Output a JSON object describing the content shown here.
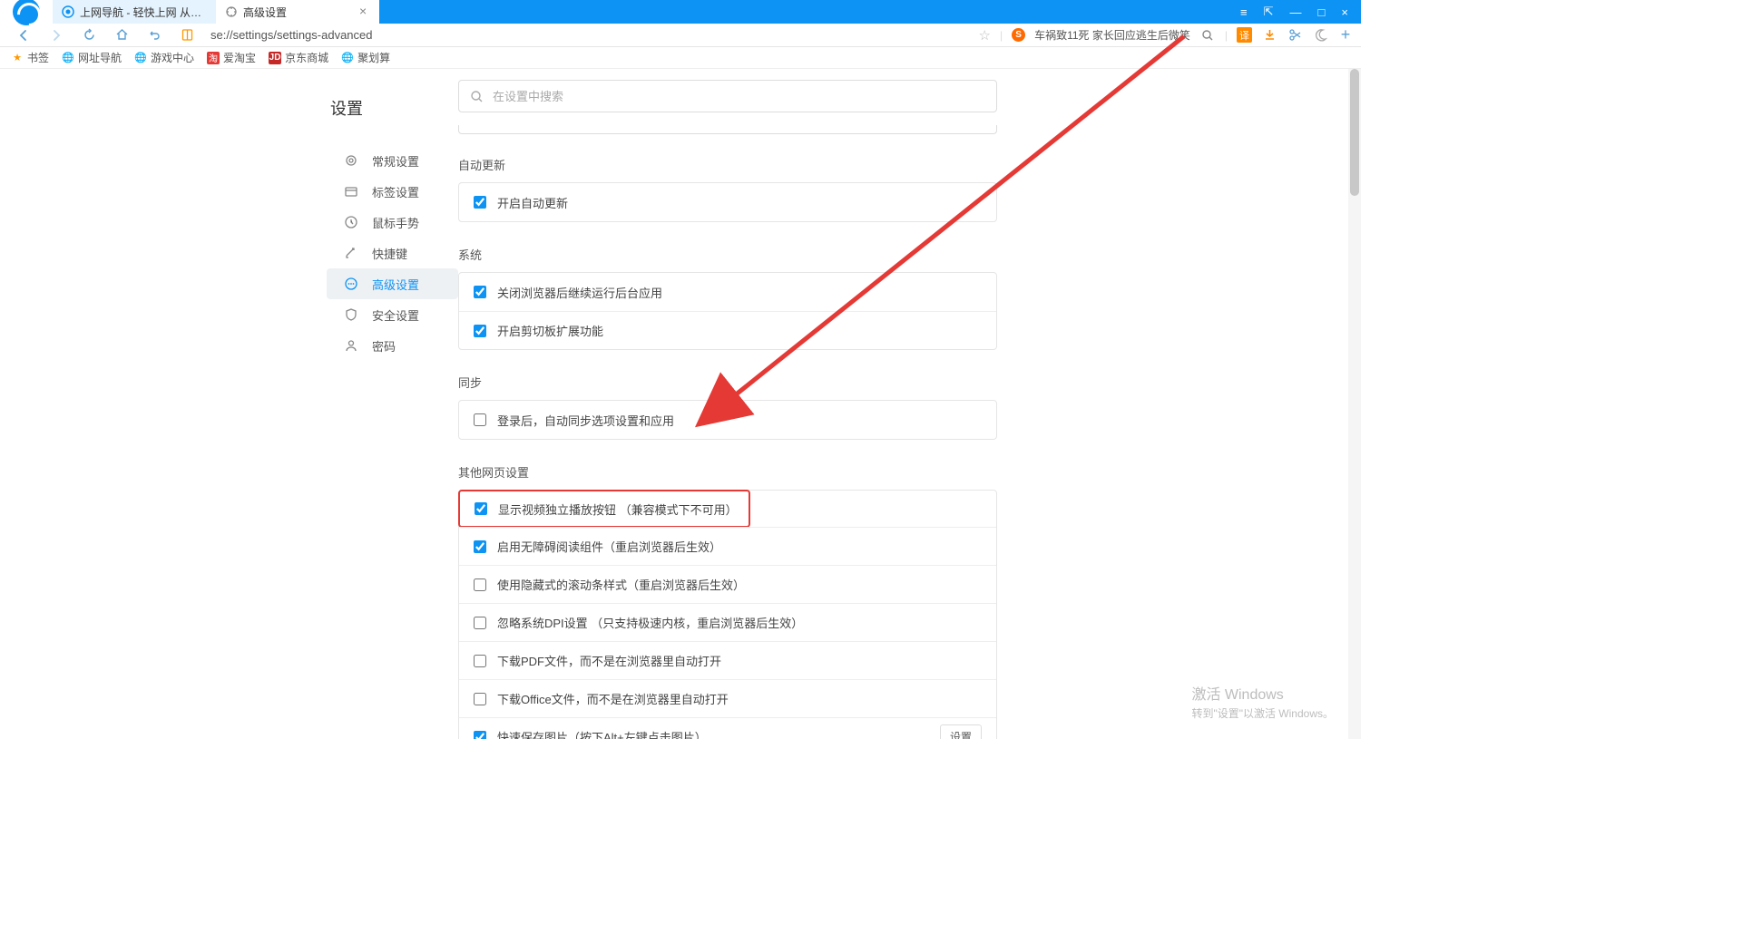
{
  "titlebar": {
    "tabs": [
      {
        "title": "上网导航 - 轻快上网 从这里开始",
        "active": false
      },
      {
        "title": "高级设置",
        "active": true
      }
    ]
  },
  "addressbar": {
    "url": "se://settings/settings-advanced",
    "news_text": "车祸致11死 家长回应逃生后微笑"
  },
  "bookmarks": {
    "items": [
      {
        "label": "书签"
      },
      {
        "label": "网址导航"
      },
      {
        "label": "游戏中心"
      },
      {
        "label": "爱淘宝"
      },
      {
        "label": "京东商城"
      },
      {
        "label": "聚划算"
      }
    ]
  },
  "settings": {
    "page_title": "设置",
    "search_placeholder": "在设置中搜索",
    "menu": [
      {
        "label": "常规设置",
        "icon": "gear"
      },
      {
        "label": "标签设置",
        "icon": "tab"
      },
      {
        "label": "鼠标手势",
        "icon": "mouse"
      },
      {
        "label": "快捷键",
        "icon": "shortcut"
      },
      {
        "label": "高级设置",
        "icon": "dots",
        "active": true
      },
      {
        "label": "安全设置",
        "icon": "shield"
      },
      {
        "label": "密码",
        "icon": "person"
      }
    ],
    "sections": {
      "auto_update": {
        "title": "自动更新",
        "items": [
          {
            "label": "开启自动更新",
            "checked": true
          }
        ]
      },
      "system": {
        "title": "系统",
        "items": [
          {
            "label": "关闭浏览器后继续运行后台应用",
            "checked": true
          },
          {
            "label": "开启剪切板扩展功能",
            "checked": true
          }
        ]
      },
      "sync": {
        "title": "同步",
        "items": [
          {
            "label": "登录后，自动同步选项设置和应用",
            "checked": false
          }
        ]
      },
      "other": {
        "title": "其他网页设置",
        "items": [
          {
            "label": "显示视频独立播放按钮 （兼容模式下不可用）",
            "checked": true,
            "highlight": true
          },
          {
            "label": "启用无障碍阅读组件（重启浏览器后生效）",
            "checked": true
          },
          {
            "label": "使用隐藏式的滚动条样式（重启浏览器后生效）",
            "checked": false
          },
          {
            "label": "忽略系统DPI设置 （只支持极速内核，重启浏览器后生效）",
            "checked": false
          },
          {
            "label": "下载PDF文件，而不是在浏览器里自动打开",
            "checked": false
          },
          {
            "label": "下载Office文件，而不是在浏览器里自动打开",
            "checked": false
          },
          {
            "label": "快速保存图片（按下Alt+左键点击图片）",
            "checked": true,
            "button": "设置"
          }
        ]
      }
    }
  },
  "watermark": {
    "title": "激活 Windows",
    "sub": "转到\"设置\"以激活 Windows。"
  }
}
